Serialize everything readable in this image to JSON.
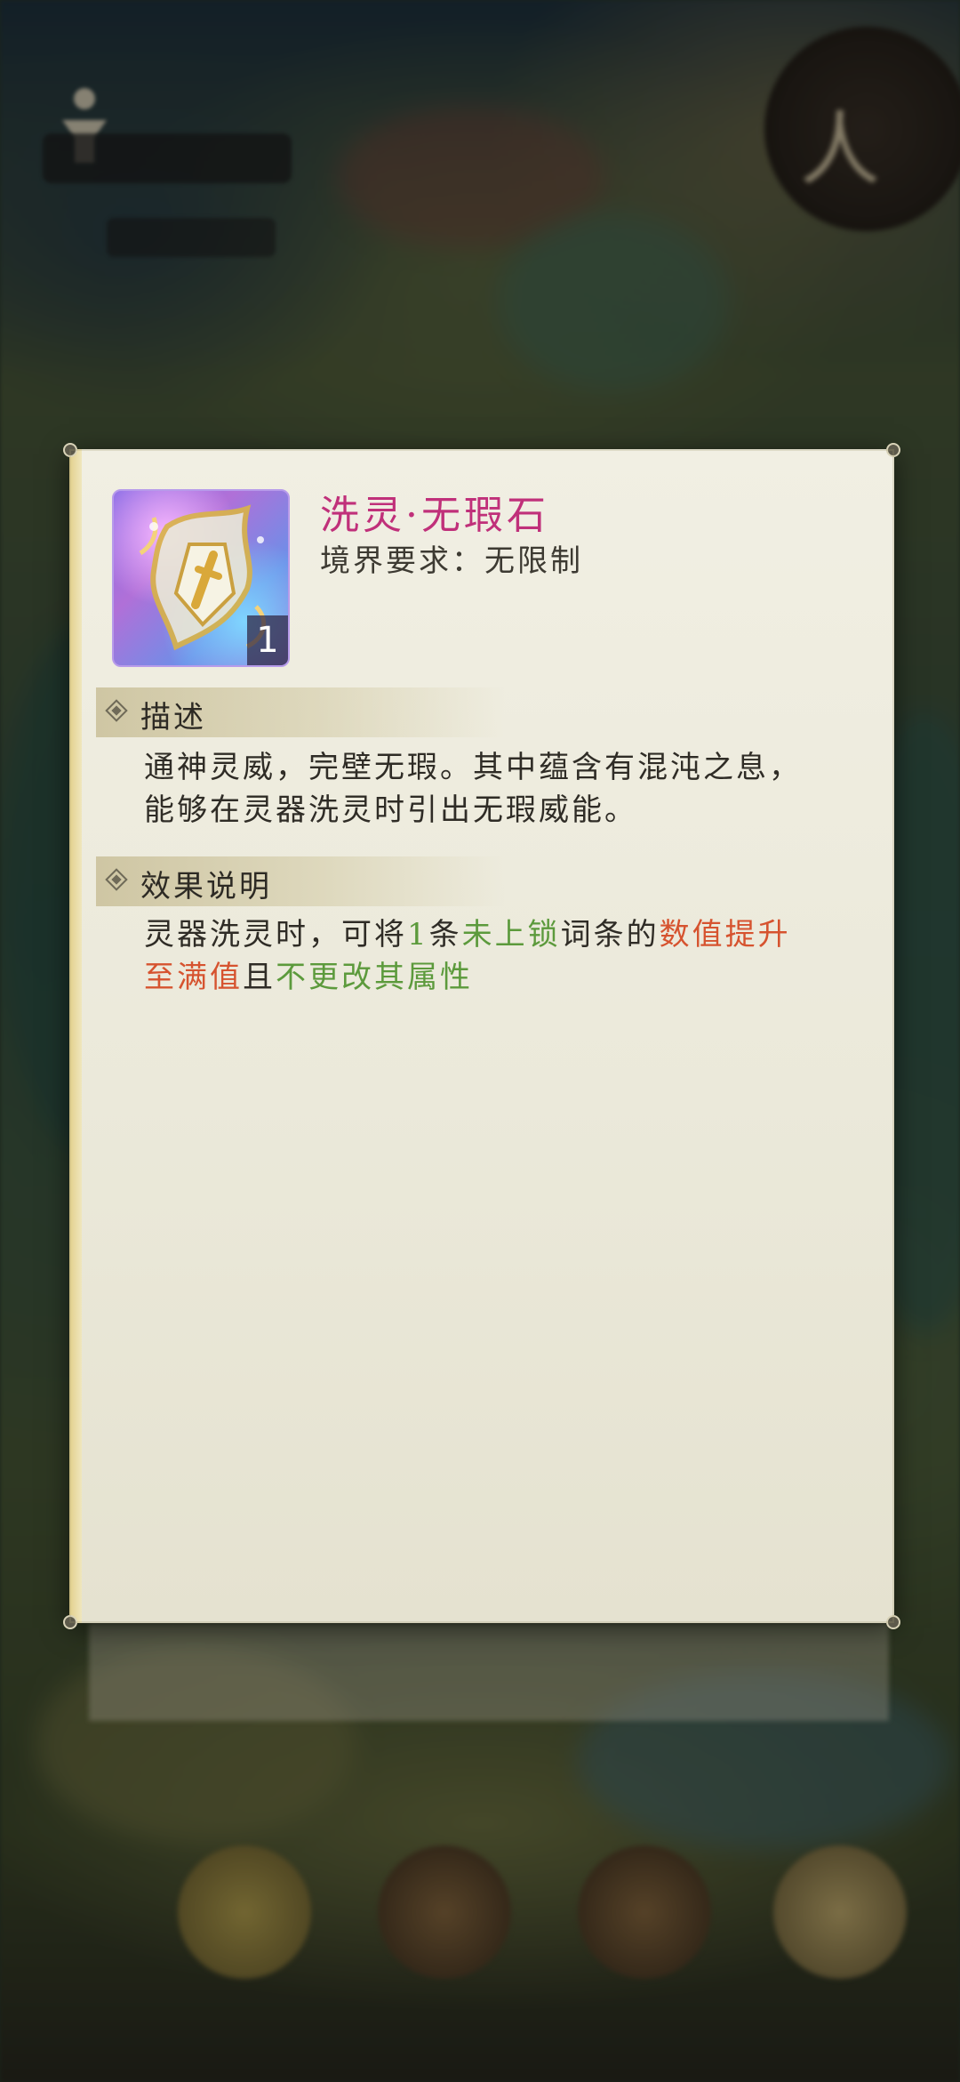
{
  "item": {
    "name": "洗灵·无瑕石",
    "realm_requirement": "境界要求：无限制",
    "count": "1"
  },
  "sections": {
    "description": {
      "title": "描述",
      "line1": "通神灵威，完壁无瑕。其中蕴含有混沌之息，",
      "line2": "能够在灵器洗灵时引出无瑕威能。"
    },
    "effect": {
      "title": "效果说明",
      "segments": {
        "s1": "灵器洗灵时，可将",
        "s2": "1",
        "s3": "条",
        "s4": "未上锁",
        "s5": "词条的",
        "s6": "数值提升",
        "s7": "至满值",
        "s8": "且",
        "s9": "不更改其属性"
      }
    }
  },
  "colors": {
    "item_name": "#c0307a",
    "highlight_red": "#d6532f",
    "highlight_green": "#5c9a3c",
    "panel_bg": "#efede0"
  },
  "icons": {
    "item": "wuxia-stone-icon",
    "section_marker": "diamond-icon"
  }
}
